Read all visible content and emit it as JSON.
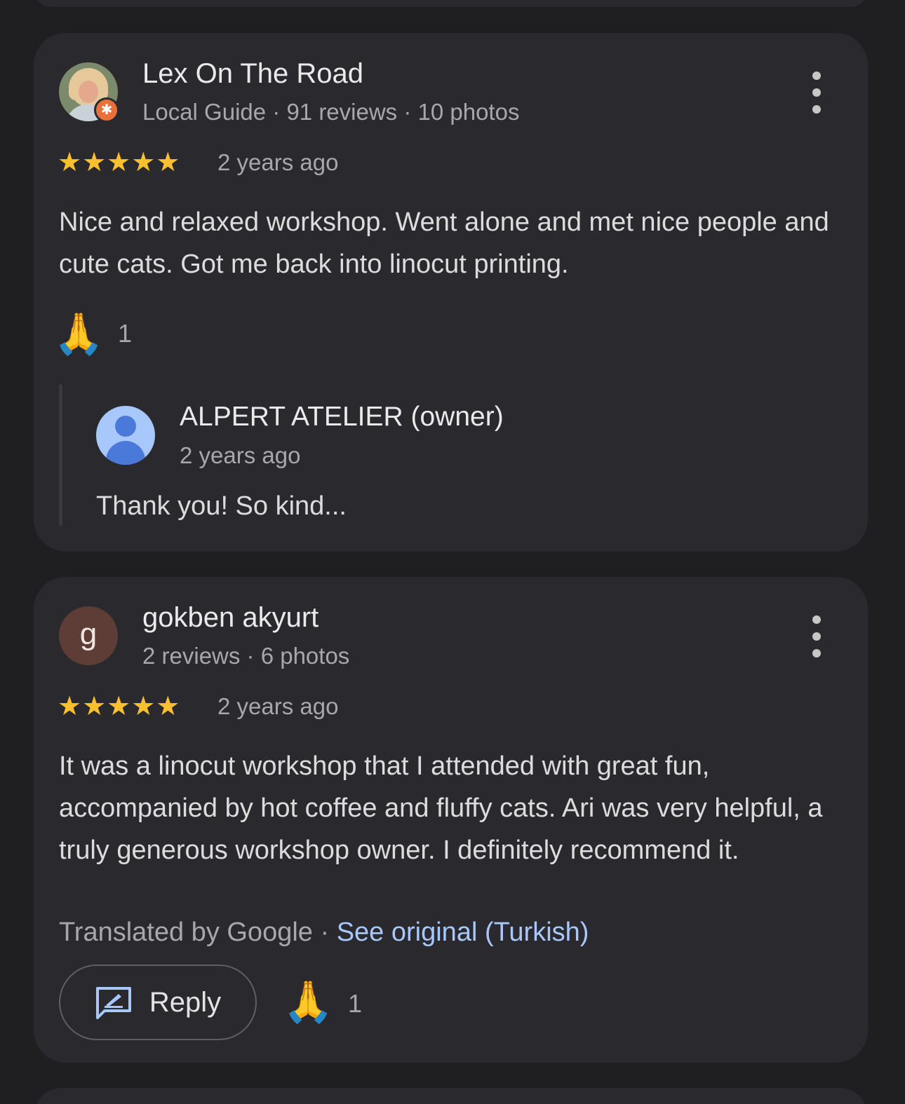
{
  "reviews": [
    {
      "author": "Lex On The Road",
      "meta": "Local Guide · 91 reviews · 10 photos",
      "stars": "★★★★★",
      "time": "2 years ago",
      "text": "Nice and relaxed workshop. Went alone and met nice people and cute cats. Got me back into linocut printing.",
      "reaction_emoji": "🙏",
      "reaction_count": "1",
      "owner_reply": {
        "name": "ALPERT ATELIER (owner)",
        "time": "2 years ago",
        "text": "Thank you! So kind..."
      }
    },
    {
      "author": "gokben akyurt",
      "avatar_letter": "g",
      "meta": "2 reviews · 6 photos",
      "stars": "★★★★★",
      "time": "2 years ago",
      "text": "It was a linocut workshop that I attended with great fun, accompanied by hot coffee and fluffy cats. Ari was very helpful, a truly generous workshop owner. I definitely recommend it.",
      "translated_by": "Translated by Google",
      "separator": " · ",
      "see_original": "See original (Turkish)",
      "reply_label": "Reply",
      "reaction_emoji": "🙏",
      "reaction_count": "1"
    }
  ],
  "icons": {
    "star_color": "#fbc02d",
    "link_color": "#a8c7fa",
    "guide_badge_color": "#e8703a",
    "owner_avatar_color": "#a8c7fa",
    "letter_avatar_color": "#5d3d35"
  }
}
